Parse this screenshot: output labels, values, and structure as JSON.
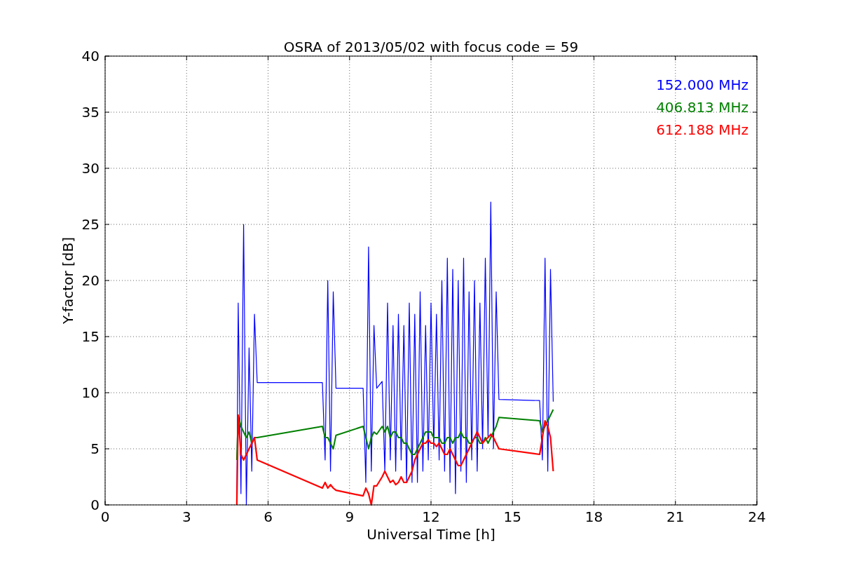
{
  "chart_data": {
    "type": "line",
    "title": "OSRA of 2013/05/02 with focus code = 59",
    "xlabel": "Universal Time [h]",
    "ylabel": "Y-factor [dB]",
    "x": [
      4.85,
      4.9,
      5.0,
      5.1,
      5.2,
      5.3,
      5.4,
      5.5,
      5.6,
      8.0,
      8.1,
      8.2,
      8.3,
      8.4,
      8.5,
      9.5,
      9.6,
      9.7,
      9.8,
      9.9,
      10.0,
      10.2,
      10.3,
      10.4,
      10.5,
      10.6,
      10.7,
      10.8,
      10.9,
      11.0,
      11.1,
      11.2,
      11.3,
      11.4,
      11.5,
      11.6,
      11.7,
      11.8,
      11.9,
      12.0,
      12.1,
      12.2,
      12.3,
      12.4,
      12.5,
      12.6,
      12.7,
      12.8,
      12.9,
      13.0,
      13.1,
      13.2,
      13.3,
      13.4,
      13.5,
      13.6,
      13.7,
      13.8,
      13.9,
      14.0,
      14.1,
      14.2,
      14.3,
      14.4,
      14.5,
      16.0,
      16.1,
      16.2,
      16.3,
      16.4,
      16.5
    ],
    "series": [
      {
        "name": "152.000 MHz",
        "color": "#0000ff",
        "values": [
          0,
          18,
          1,
          25,
          0,
          14,
          3,
          17,
          10.9,
          10.9,
          4,
          20,
          3,
          19,
          10.4,
          10.4,
          2,
          23,
          3,
          16,
          10.4,
          11,
          3,
          18,
          4,
          16,
          3,
          17,
          4,
          16,
          2,
          18,
          2,
          17,
          2,
          19,
          3,
          16,
          4,
          18,
          5,
          17,
          4,
          20,
          3,
          22,
          2,
          21,
          1,
          20,
          3,
          22,
          2,
          19,
          4,
          20,
          3,
          18,
          5,
          22,
          6,
          27,
          5,
          19,
          9.4,
          9.3,
          4,
          22,
          3,
          21,
          9.2
        ]
      },
      {
        "name": "406.813 MHz",
        "color": "#008000",
        "values": [
          4,
          8,
          7,
          6.5,
          6,
          6.5,
          5.5,
          6,
          6,
          7,
          6,
          6,
          5.5,
          5,
          6.2,
          7,
          6,
          5,
          6,
          6.5,
          6.3,
          7,
          6.5,
          7,
          6,
          6.5,
          6.5,
          6,
          6,
          5.5,
          5.5,
          5,
          4.5,
          4.5,
          5,
          5.5,
          6,
          6.5,
          6.5,
          6.5,
          6,
          6,
          6,
          5.5,
          5.5,
          6,
          6,
          5.5,
          6,
          6,
          6.5,
          6,
          6,
          5.5,
          5.5,
          6,
          6,
          5.5,
          5.5,
          6,
          5.5,
          6,
          6.5,
          7,
          7.8,
          7.5,
          6.5,
          7,
          7.5,
          8,
          8.5
        ]
      },
      {
        "name": "612.188 MHz",
        "color": "#ff0000",
        "values": [
          0,
          8,
          4.5,
          4,
          4.5,
          5,
          5.5,
          6,
          4,
          1.5,
          2,
          1.5,
          1.8,
          1.5,
          1.3,
          0.8,
          1.5,
          1,
          0,
          1.7,
          1.7,
          2.5,
          3,
          2.5,
          2,
          2.2,
          1.8,
          2,
          2.5,
          2,
          2,
          2.5,
          3,
          4,
          4.5,
          5,
          5.5,
          5.5,
          5.8,
          5.5,
          5.5,
          5.2,
          5.5,
          5,
          4.5,
          4.5,
          5,
          4.5,
          4,
          3.5,
          3.5,
          4,
          4.5,
          5,
          5.5,
          6,
          6.5,
          6,
          5.5,
          5.8,
          6,
          6.3,
          6,
          5.5,
          5,
          4.5,
          6,
          7.5,
          7,
          6,
          3
        ]
      }
    ],
    "grid": true,
    "xlim": [
      0,
      24
    ],
    "ylim": [
      0,
      40
    ],
    "xticks": [
      0,
      3,
      6,
      9,
      12,
      15,
      18,
      21,
      24
    ],
    "yticks": [
      0,
      5,
      10,
      15,
      20,
      25,
      30,
      35,
      40
    ]
  }
}
